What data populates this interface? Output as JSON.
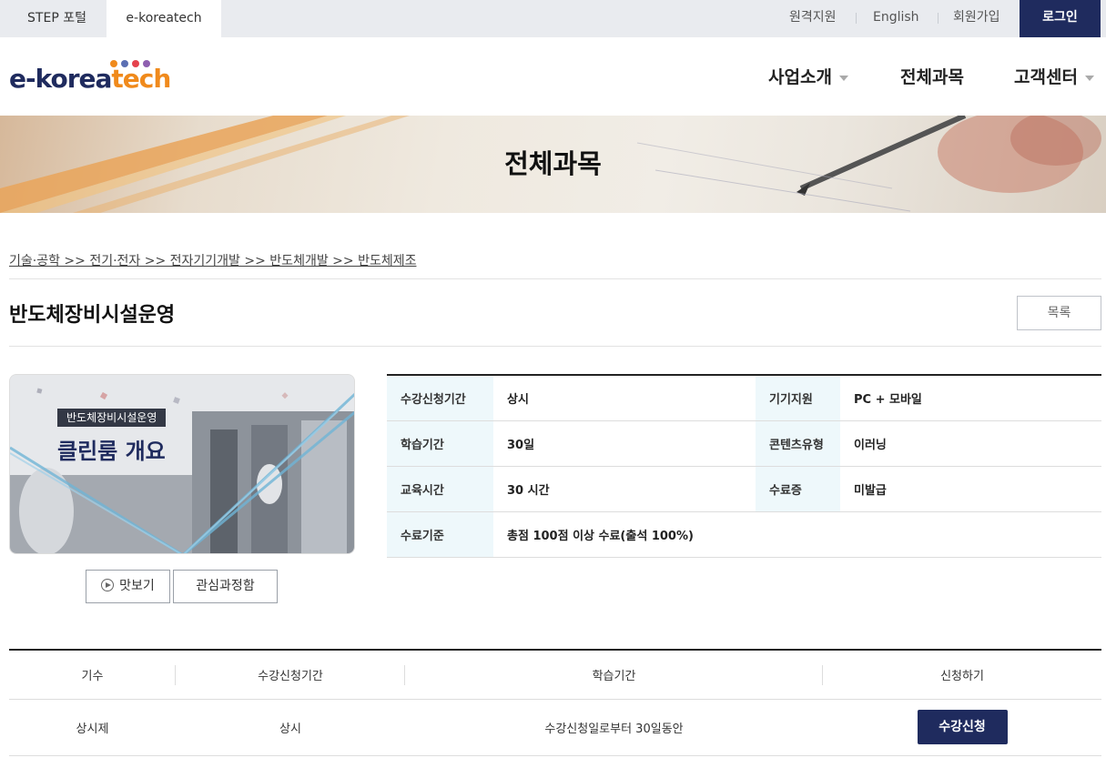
{
  "topbar": {
    "tabs": [
      "STEP 포털",
      "e-koreatech"
    ],
    "links": [
      "원격지원",
      "English",
      "회원가입"
    ],
    "login": "로그인"
  },
  "header": {
    "logo_part1": "e-korea",
    "logo_part2": "tech",
    "nav": [
      "사업소개",
      "전체과목",
      "고객센터"
    ]
  },
  "banner": {
    "title": "전체과목"
  },
  "breadcrumb": "기술·공학 >> 전기·전자 >> 전자기기개발 >> 반도체개발 >> 반도체제조",
  "course": {
    "title": "반도체장비시설운영",
    "list_button": "목록",
    "thumb_sub": "반도체장비시설운영",
    "thumb_main": "클린룸 개요",
    "preview_button": "맛보기",
    "fav_button": "관심과정함"
  },
  "info": {
    "r1": {
      "k1": "수강신청기간",
      "v1": "상시",
      "k2": "기기지원",
      "v2": "PC + 모바일"
    },
    "r2": {
      "k1": "학습기간",
      "v1": "30일",
      "k2": "콘텐츠유형",
      "v2": "이러닝"
    },
    "r3": {
      "k1": "교육시간",
      "v1": "30 시간",
      "k2": "수료증",
      "v2": "미발급"
    },
    "r4": {
      "k1": "수료기준",
      "v1": "총점 100점 이상 수료(출석 100%)"
    }
  },
  "schedule": {
    "headers": [
      "기수",
      "수강신청기간",
      "학습기간",
      "신청하기"
    ],
    "row": {
      "term": "상시제",
      "period": "상시",
      "duration": "수강신청일로부터 30일동안",
      "apply": "수강신청"
    }
  },
  "colors": {
    "navy": "#1f2b5e",
    "orange": "#f08a1c",
    "th_bg": "#eef8fb"
  }
}
